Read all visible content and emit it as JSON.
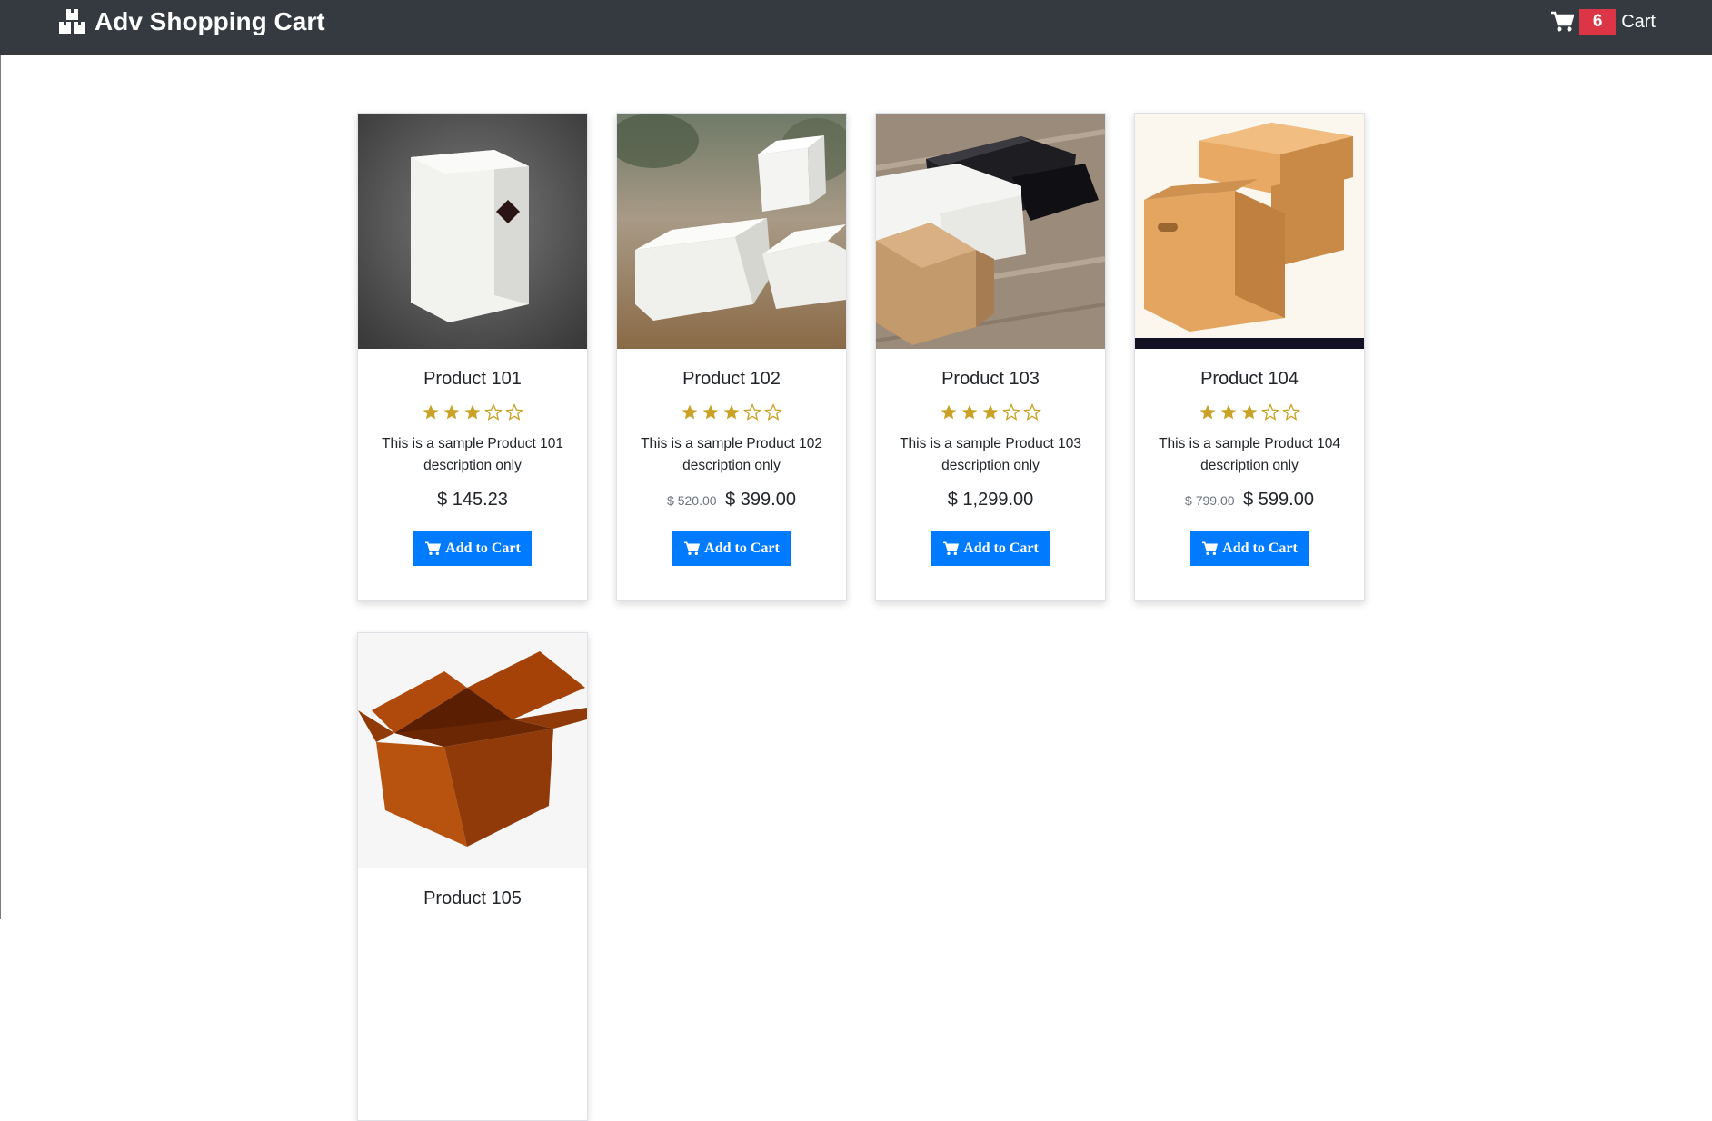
{
  "navbar": {
    "brand": "Adv Shopping Cart",
    "cart_count": "6",
    "cart_label": "Cart",
    "background": "#343a40"
  },
  "colors": {
    "star": "#c9a227",
    "button": "#007bff",
    "badge": "#dc3545"
  },
  "products": [
    {
      "title": "Product 101",
      "rating": 3,
      "max_rating": 5,
      "description": "This is a sample Product 101 description only",
      "old_price": "",
      "price": "$ 145.23",
      "button": "Add to Cart"
    },
    {
      "title": "Product 102",
      "rating": 3,
      "max_rating": 5,
      "description": "This is a sample Product 102 description only",
      "old_price": "$ 520.00",
      "price": "$ 399.00",
      "button": "Add to Cart"
    },
    {
      "title": "Product 103",
      "rating": 3,
      "max_rating": 5,
      "description": "This is a sample Product 103 description only",
      "old_price": "",
      "price": "$ 1,299.00",
      "button": "Add to Cart"
    },
    {
      "title": "Product 104",
      "rating": 3,
      "max_rating": 5,
      "description": "This is a sample Product 104 description only",
      "old_price": "$ 799.00",
      "price": "$ 599.00",
      "button": "Add to Cart"
    },
    {
      "title": "Product 105"
    }
  ]
}
